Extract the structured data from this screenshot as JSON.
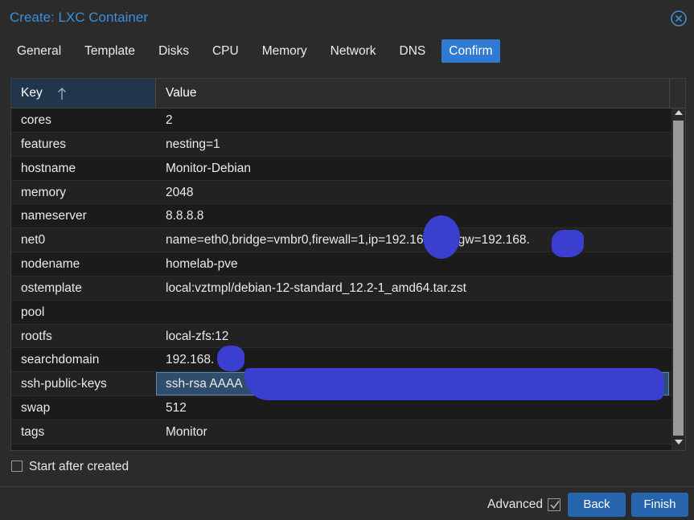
{
  "window": {
    "title": "Create: LXC Container",
    "close_icon": "close-circle-icon"
  },
  "tabs": [
    {
      "label": "General"
    },
    {
      "label": "Template"
    },
    {
      "label": "Disks"
    },
    {
      "label": "CPU"
    },
    {
      "label": "Memory"
    },
    {
      "label": "Network"
    },
    {
      "label": "DNS"
    },
    {
      "label": "Confirm",
      "active": true
    }
  ],
  "grid": {
    "columns": {
      "key": "Key",
      "value": "Value"
    },
    "sort_icon": "arrow-up-icon",
    "rows": [
      {
        "key": "cores",
        "value": "2"
      },
      {
        "key": "features",
        "value": "nesting=1"
      },
      {
        "key": "hostname",
        "value": "Monitor-Debian"
      },
      {
        "key": "memory",
        "value": "2048"
      },
      {
        "key": "nameserver",
        "value": "8.8.8.8"
      },
      {
        "key": "net0",
        "value": "name=eth0,bridge=vmbr0,firewall=1,ip=192.168.   /24,gw=192.168."
      },
      {
        "key": "nodename",
        "value": "homelab-pve"
      },
      {
        "key": "ostemplate",
        "value": "local:vztmpl/debian-12-standard_12.2-1_amd64.tar.zst"
      },
      {
        "key": "pool",
        "value": ""
      },
      {
        "key": "rootfs",
        "value": "local-zfs:12"
      },
      {
        "key": "searchdomain",
        "value": "192.168."
      },
      {
        "key": "ssh-public-keys",
        "value": "ssh-rsa AAAA",
        "selected": true
      },
      {
        "key": "swap",
        "value": "512"
      },
      {
        "key": "tags",
        "value": "Monitor"
      }
    ]
  },
  "footer": {
    "start_after_created": "Start after created",
    "start_checked": false,
    "advanced_label": "Advanced",
    "advanced_checked": true,
    "back_label": "Back",
    "finish_label": "Finish"
  },
  "colors": {
    "accent": "#2f7bd1",
    "title": "#3d8fd9",
    "button": "#2766ae",
    "redaction": "#3a3fcf"
  }
}
